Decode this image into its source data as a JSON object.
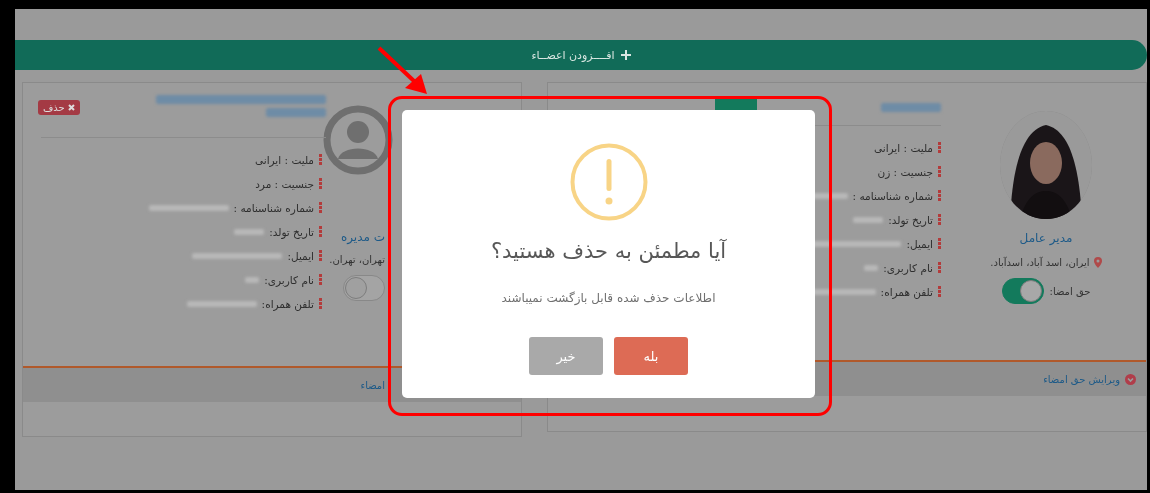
{
  "add_members_button": {
    "label": "افــــزودن اعضــاء"
  },
  "cards": [
    {
      "verified": true,
      "role": "مدیر عامل",
      "location": "ایران، اسد آباد، اسدآباد.",
      "signature_label": "حق امضا:",
      "signature_on": true,
      "fields": [
        {
          "label": "ملیت : ایرانی",
          "redacted": false
        },
        {
          "label": "جنسیت : زن",
          "redacted": false
        },
        {
          "label": "شماره شناسنامه :",
          "redacted": true
        },
        {
          "label": "تاریخ تولد:",
          "redacted": true
        },
        {
          "label": "ایمیل:",
          "redacted": true
        },
        {
          "label": "نام کاربری:",
          "redacted": true
        },
        {
          "label": "تلفن همراه:",
          "redacted": true
        }
      ],
      "footer_link": "ویرایش حق امضاء"
    },
    {
      "kind": "placeholder",
      "verified": false,
      "delete_label": "حذف",
      "role": "ت مدیره",
      "location": "تهران، تهران.",
      "signature_on": false,
      "fields": [
        {
          "label": "ملیت : ایرانی",
          "redacted": false
        },
        {
          "label": "جنسیت : مرد",
          "redacted": false
        },
        {
          "label": "شماره شناسنامه :",
          "redacted": true
        },
        {
          "label": "تاریخ تولد:",
          "redacted": true
        },
        {
          "label": "ایمیل:",
          "redacted": true
        },
        {
          "label": "نام کاربری:",
          "redacted": true
        },
        {
          "label": "تلفن همراه:",
          "redacted": true
        }
      ],
      "footer_link": "امضاء"
    }
  ],
  "dialog": {
    "title": "آیا مطمئن به حذف هستید؟",
    "message": "اطلاعات حذف شده قابل بازگشت نمیباشند",
    "confirm": "بله",
    "cancel": "خیر"
  }
}
